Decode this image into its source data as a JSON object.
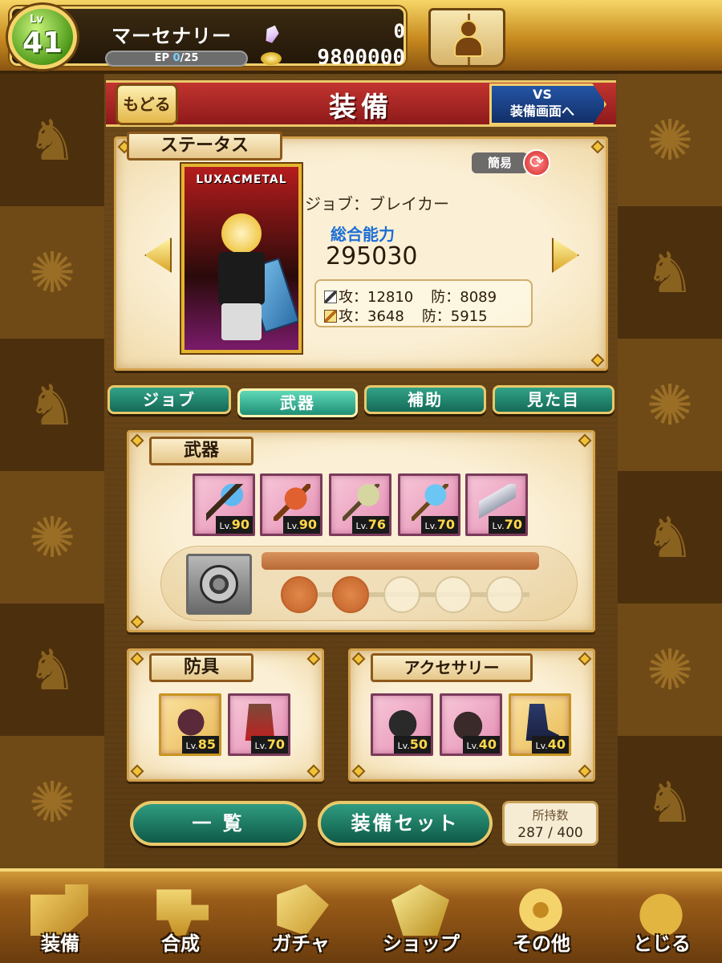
{
  "header": {
    "level_label": "Lv",
    "level": "41",
    "player_name": "マーセナリー",
    "ep_label": "EP",
    "ep_current": "0",
    "ep_max": "/25",
    "gems": "0",
    "gold": "9800000",
    "icons": {
      "gem": "crystal-icon",
      "gold": "coin-icon",
      "friends": "friend-book-icon"
    }
  },
  "title_bar": {
    "back_label": "もどる",
    "title": "装備",
    "vs_line1": "VS",
    "vs_line2": "装備画面へ"
  },
  "status": {
    "tag": "ステータス",
    "simple_label": "簡易",
    "card_logo": "LUXACMETAL",
    "job": "ジョブ：ブレイカー",
    "power_label": "総合能力",
    "power_value": "295030",
    "phys_attack": "攻：12810",
    "phys_defense": "防：8089",
    "mag_attack": "攻：3648",
    "mag_defense": "防：5915"
  },
  "tabs": [
    {
      "label": "ジョブ",
      "active": false
    },
    {
      "label": "武器",
      "active": true
    },
    {
      "label": "補助",
      "active": false
    },
    {
      "label": "見た目",
      "active": false
    }
  ],
  "weapons": {
    "tag": "武器",
    "items": [
      {
        "icon": "blue-axe-icon",
        "lv_label": "Lv.",
        "lv": "90"
      },
      {
        "icon": "dragon-claw-icon",
        "lv_label": "Lv.",
        "lv": "90"
      },
      {
        "icon": "halberd-icon",
        "lv_label": "Lv.",
        "lv": "76"
      },
      {
        "icon": "ice-hammer-icon",
        "lv_label": "Lv.",
        "lv": "70"
      },
      {
        "icon": "wing-blade-icon",
        "lv_label": "Lv.",
        "lv": "70"
      }
    ],
    "skill_emblem_icon": "wheel-emblem-icon",
    "skill_dots_filled": 2,
    "skill_dots_total": 5
  },
  "armor": {
    "tag": "防具",
    "items": [
      {
        "icon": "helm-icon",
        "lv_label": "Lv.",
        "lv": "85",
        "frame": "gold"
      },
      {
        "icon": "armor-icon",
        "lv_label": "Lv.",
        "lv": "70",
        "frame": "pink"
      }
    ]
  },
  "accessory": {
    "tag": "アクセサリー",
    "items": [
      {
        "icon": "mask-icon",
        "lv_label": "Lv.",
        "lv": "50",
        "frame": "pink"
      },
      {
        "icon": "glove-icon",
        "lv_label": "Lv.",
        "lv": "40",
        "frame": "pink"
      },
      {
        "icon": "boots-icon",
        "lv_label": "Lv.",
        "lv": "40",
        "frame": "gold"
      }
    ]
  },
  "actions": {
    "list_label": "一 覧",
    "set_label": "装備セット",
    "owned_label": "所持数",
    "owned_value": "287 / 400"
  },
  "nav": [
    {
      "label": "装備",
      "icon": "equip-icon"
    },
    {
      "label": "合成",
      "icon": "hammer-icon"
    },
    {
      "label": "ガチャ",
      "icon": "gacha-icon"
    },
    {
      "label": "ショップ",
      "icon": "shop-crystal-icon"
    },
    {
      "label": "その他",
      "icon": "gear-icon"
    },
    {
      "label": "とじる",
      "icon": "close-bag-icon"
    }
  ],
  "colors": {
    "accent_green": "#1f8f75",
    "title_red": "#c2342f",
    "gold": "#e9c86a",
    "power_blue": "#1c6ed6"
  }
}
